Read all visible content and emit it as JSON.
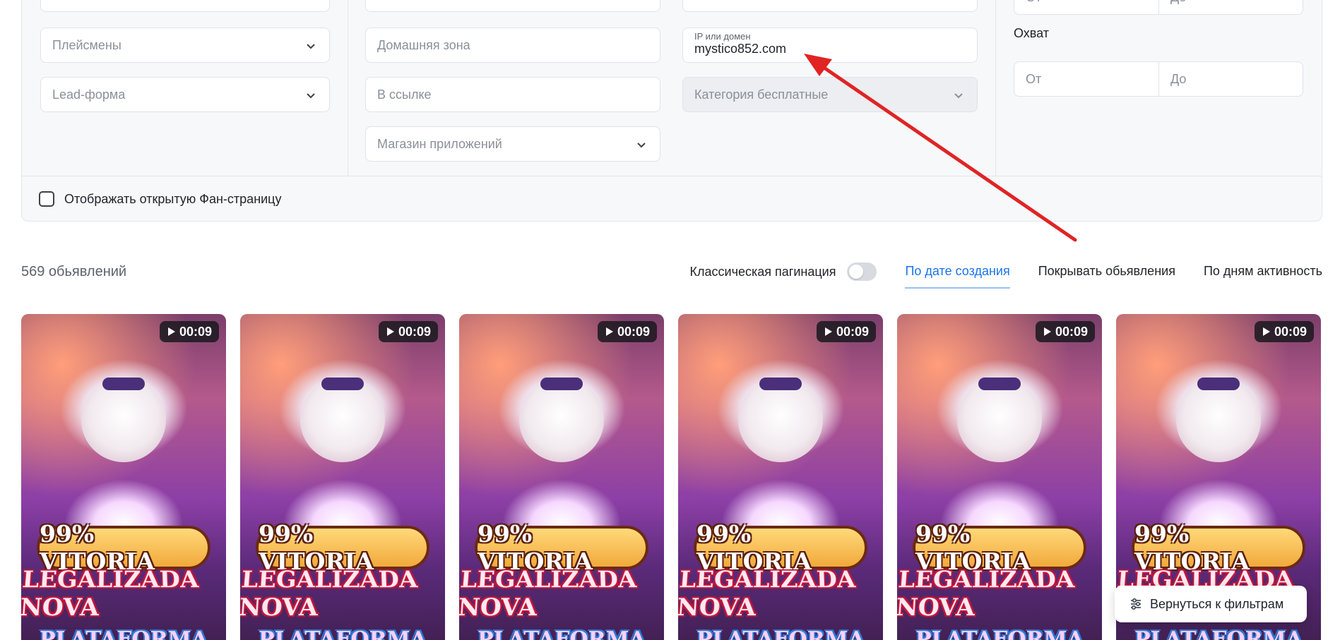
{
  "filters": {
    "placements_placeholder": "Плейсмены",
    "lead_form_placeholder": "Lead-форма",
    "home_zone_placeholder": "Домашняя зона",
    "in_link_placeholder": "В ссылке",
    "app_store_placeholder": "Магазин приложений",
    "ip_domain_label": "IP или домен",
    "ip_domain_value": "mystico852.com",
    "category_placeholder": "Категория бесплатные",
    "range_top": {
      "from": "От",
      "to": "До"
    },
    "reach_label": "Охват",
    "reach_range": {
      "from": "От",
      "to": "До"
    },
    "show_open_fanpage_label": "Отображать открытую Фан-страницу"
  },
  "toolbar": {
    "ads_count": "569 обьявлений",
    "classic_pagination_label": "Классическая пагинация",
    "sort_by_creation_date": "По дате создания",
    "cover_ads": "Покрывать обьявления",
    "by_days_active": "По дням активность"
  },
  "cards": [
    {
      "duration": "00:09",
      "banner": "99% VITORIA",
      "headline": "LEGALIZADA NOVA",
      "subline": "PLATAFORMA"
    },
    {
      "duration": "00:09",
      "banner": "99% VITORIA",
      "headline": "LEGALIZADA NOVA",
      "subline": "PLATAFORMA"
    },
    {
      "duration": "00:09",
      "banner": "99% VITORIA",
      "headline": "LEGALIZADA NOVA",
      "subline": "PLATAFORMA"
    },
    {
      "duration": "00:09",
      "banner": "99% VITORIA",
      "headline": "LEGALIZADA NOVA",
      "subline": "PLATAFORMA"
    },
    {
      "duration": "00:09",
      "banner": "99% VITORIA",
      "headline": "LEGALIZADA NOVA",
      "subline": "PLATAFORMA"
    },
    {
      "duration": "00:09",
      "banner": "99% VITORIA",
      "headline": "LEGALIZADA NOVA",
      "subline": "PLATAFORMA"
    }
  ],
  "back_to_filters_label": "Вернуться к фильтрам",
  "icons": {
    "dropdown": "chevron-down-icon",
    "play": "play-icon",
    "filters": "sliders-icon"
  },
  "colors": {
    "accent": "#1a73e8",
    "annotation_arrow": "#e02424",
    "panel_bg": "#f7f8fa"
  }
}
